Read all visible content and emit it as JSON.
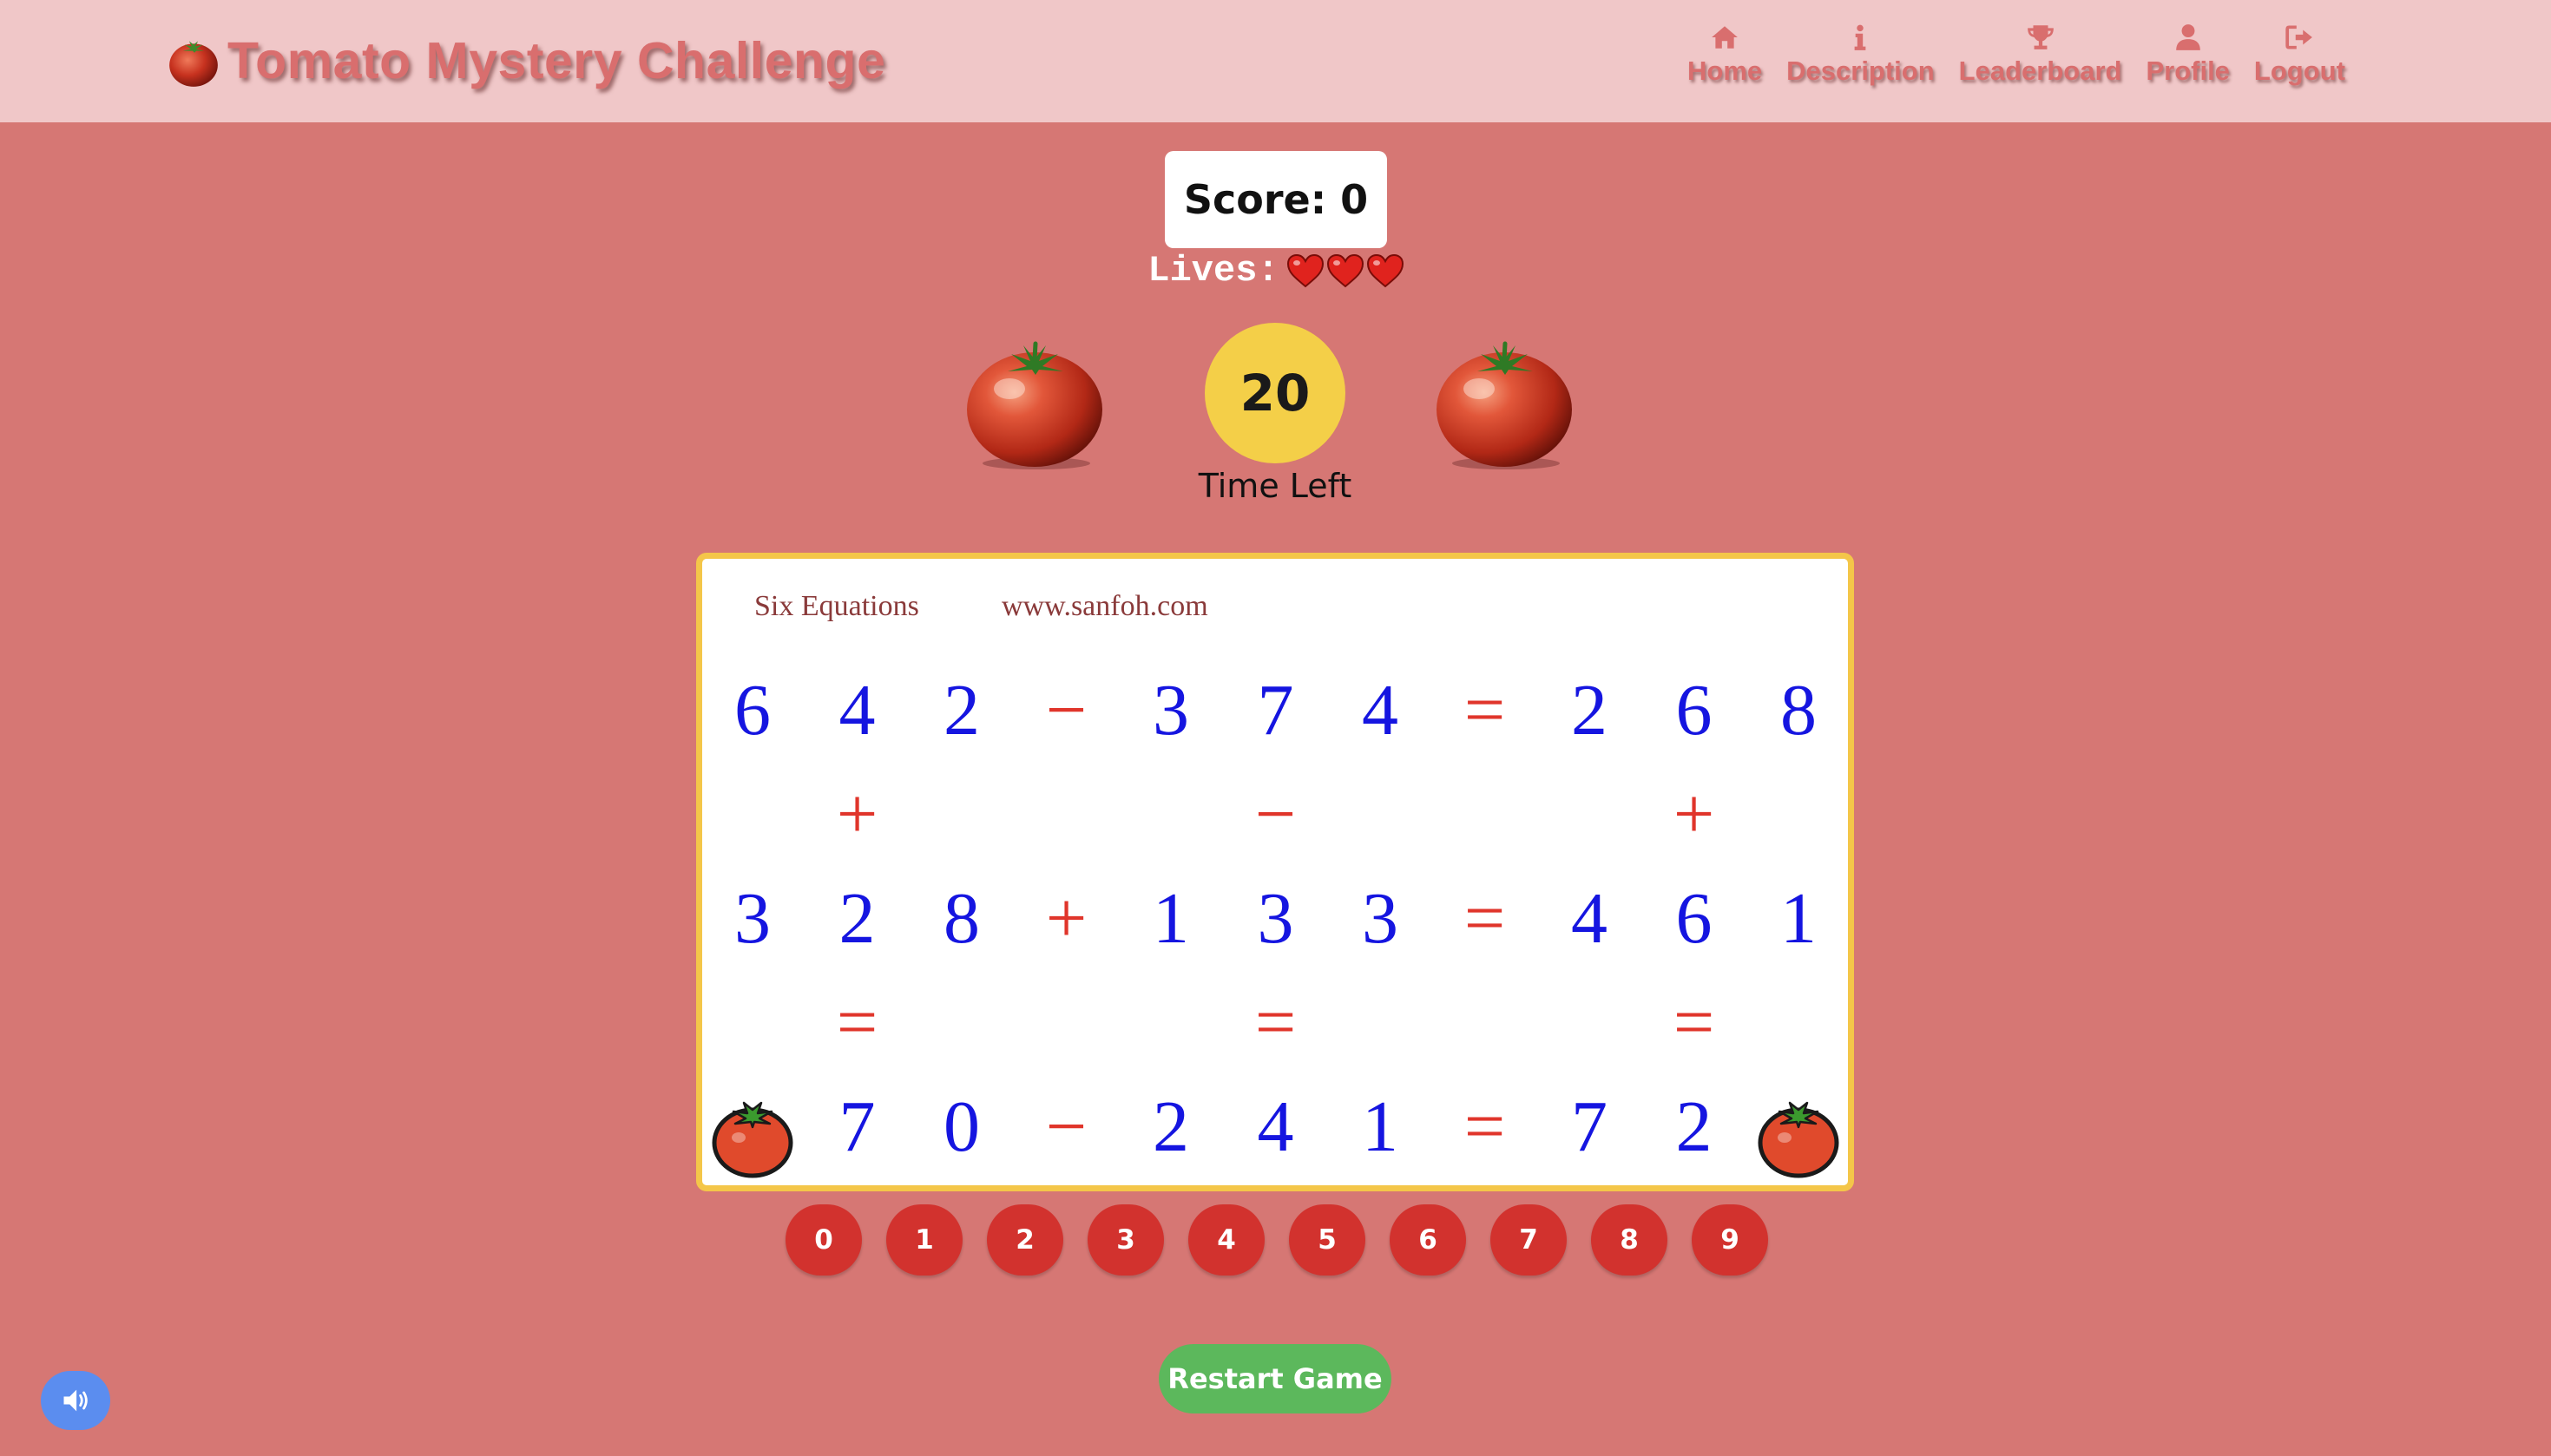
{
  "header": {
    "title": "Tomato Mystery Challenge",
    "brand_icon": "tomato-icon",
    "nav": [
      {
        "label": "Home",
        "icon": "home-icon"
      },
      {
        "label": "Description",
        "icon": "info-icon"
      },
      {
        "label": "Leaderboard",
        "icon": "trophy-icon"
      },
      {
        "label": "Profile",
        "icon": "user-icon"
      },
      {
        "label": "Logout",
        "icon": "logout-icon"
      }
    ]
  },
  "game": {
    "score_text": "Score: 0",
    "lives_label": "Lives:",
    "lives": 3,
    "timer_value": "20",
    "timer_label": "Time Left"
  },
  "puzzle": {
    "caption_left": "Six Equations",
    "caption_right": "www.sanfoh.com",
    "grid": [
      [
        "6",
        "4",
        "2",
        "−",
        "3",
        "7",
        "4",
        "=",
        "2",
        "6",
        "8"
      ],
      [
        "",
        "+",
        "",
        "",
        "",
        "−",
        "",
        "",
        "",
        "+",
        ""
      ],
      [
        "3",
        "2",
        "8",
        "+",
        "1",
        "3",
        "3",
        "=",
        "4",
        "6",
        "1"
      ],
      [
        "",
        "=",
        "",
        "",
        "",
        "=",
        "",
        "",
        "",
        "=",
        ""
      ],
      [
        "?",
        "7",
        "0",
        "−",
        "2",
        "4",
        "1",
        "=",
        "7",
        "2",
        "?"
      ]
    ],
    "hidden_marker": "?"
  },
  "number_buttons": [
    "0",
    "1",
    "2",
    "3",
    "4",
    "5",
    "6",
    "7",
    "8",
    "9"
  ],
  "restart_label": "Restart Game",
  "sound_icon": "speaker-icon",
  "colors": {
    "background": "#d67774",
    "header": "#f0c7c8",
    "title_text": "#d96e6e",
    "digit": "#1515e0",
    "operator": "#e0352b",
    "board_border": "#f4c649",
    "timer": "#f4cf48",
    "number_button": "#d2322e",
    "restart_button": "#5cb85c",
    "sound_button": "#5b8def"
  }
}
